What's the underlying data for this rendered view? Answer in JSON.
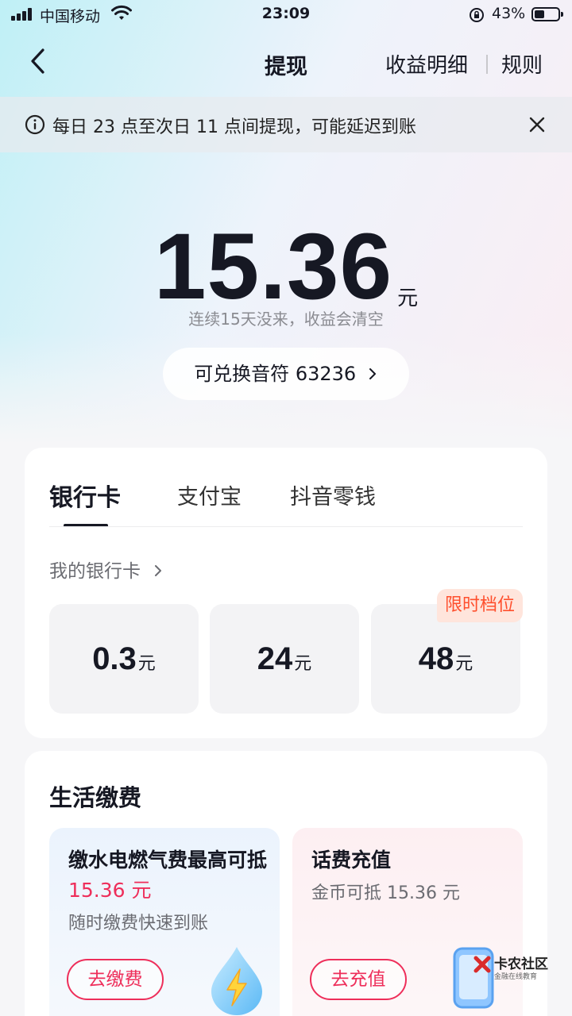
{
  "status_bar": {
    "carrier": "中国移动",
    "time": "23:09",
    "battery_percent": "43%",
    "battery_level": 0.43
  },
  "nav": {
    "title": "提现",
    "detail_link": "收益明细",
    "rules_link": "规则"
  },
  "notice": {
    "text": "每日 23 点至次日 11 点间提现，可能延迟到账"
  },
  "balance": {
    "amount": "15.36",
    "unit": "元",
    "warning": "连续15天没来，收益会清空",
    "exchange_label": "可兑换音符 63236"
  },
  "withdraw": {
    "tabs": [
      "银行卡",
      "支付宝",
      "抖音零钱"
    ],
    "active_tab": "银行卡",
    "my_card_label": "我的银行卡",
    "options": [
      {
        "value": "0.3",
        "unit": "元"
      },
      {
        "value": "24",
        "unit": "元"
      },
      {
        "value": "48",
        "unit": "元"
      }
    ],
    "limited_badge": "限时档位"
  },
  "bills": {
    "title": "生活缴费",
    "utilities": {
      "title_prefix": "缴水电燃气费最高可抵",
      "amount_text": "15.36 元",
      "subtitle": "随时缴费快速到账",
      "button": "去缴费"
    },
    "phone": {
      "title": "话费充值",
      "subtitle": "金币可抵 15.36 元",
      "button": "去充值"
    }
  },
  "watermark": {
    "name": "卡农社区",
    "tagline": "金融在线教育"
  },
  "colors": {
    "accent_red": "#ee2e5a",
    "badge_orange": "#ff4f2d",
    "text_primary": "#161823"
  }
}
